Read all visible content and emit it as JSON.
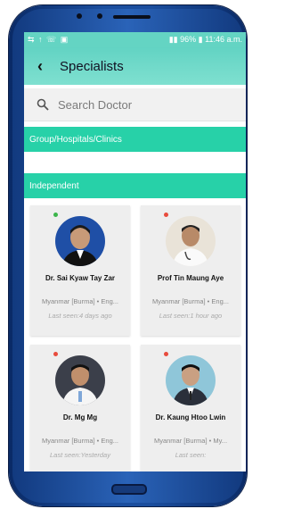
{
  "status": {
    "left_icons": "⇆ ↑ ☏ ▣",
    "battery": "96%",
    "time": "11:46 a.m."
  },
  "header": {
    "title": "Specialists"
  },
  "search": {
    "placeholder": "Search Doctor"
  },
  "sections": {
    "group": "Group/Hospitals/Clinics",
    "independent": "Independent"
  },
  "colors": {
    "accent": "#64d4c3",
    "section": "#27d1a8",
    "online": "#3bb54a",
    "offline": "#e84b3c"
  },
  "doctors": [
    {
      "name": "Dr. Sai Kyaw Tay Zar",
      "languages": "Myanmar [Burma] • Eng...",
      "last_seen": "Last seen:4 days ago",
      "status": "online"
    },
    {
      "name": "Prof Tin Maung Aye",
      "languages": "Myanmar [Burma] • Eng...",
      "last_seen": "Last seen:1 hour ago",
      "status": "offline"
    },
    {
      "name": "Dr. Mg Mg",
      "languages": "Myanmar [Burma] • Eng...",
      "last_seen": "Last seen:Yesterday",
      "status": "offline"
    },
    {
      "name": "Dr. Kaung Htoo Lwin",
      "languages": "Myanmar [Burma] • My...",
      "last_seen": "Last seen:",
      "status": "offline"
    }
  ]
}
